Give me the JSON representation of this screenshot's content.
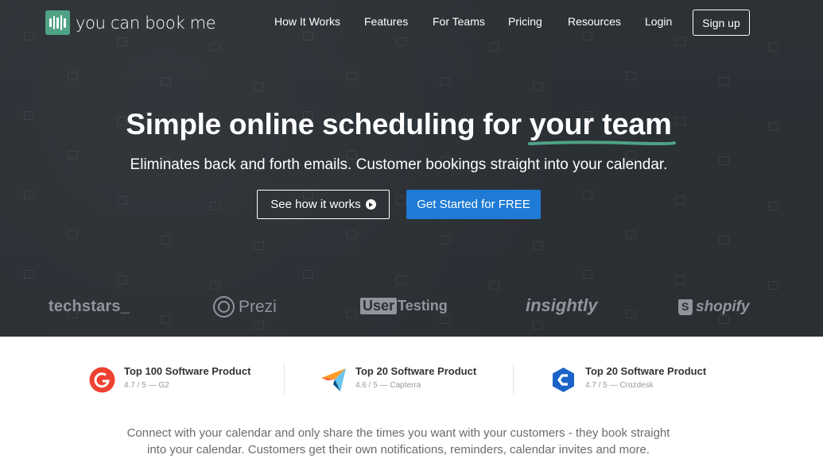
{
  "brand": {
    "name": "you can book me",
    "accent": "#4fa286"
  },
  "nav": {
    "items": [
      "How It Works",
      "Features",
      "For Teams",
      "Pricing",
      "Resources",
      "Login"
    ],
    "signup": "Sign up"
  },
  "hero": {
    "headline_main": "Simple online scheduling for",
    "headline_em": "your team",
    "subline": "Eliminates back and forth emails. Customer bookings straight into your calendar.",
    "cta_secondary": "See how it works",
    "cta_primary": "Get Started for FREE",
    "primary_color": "#1f7bd6"
  },
  "clients": [
    "techstars_",
    "Prezi",
    "User",
    "Testing",
    "insightly",
    "shopify"
  ],
  "awards": [
    {
      "title": "Top 100 Software Product",
      "rating": "4.7 / 5 — G2",
      "icon": "g2-icon"
    },
    {
      "title": "Top 20 Software Product",
      "rating": "4.6 / 5 — Capterra",
      "icon": "capterra-icon"
    },
    {
      "title": "Top 20 Software Product",
      "rating": "4.7 / 5 — Crozdesk",
      "icon": "crozdesk-icon"
    }
  ],
  "intro": "Connect with your calendar and only share the times you want with your customers - they book straight into your calendar. Customers get their own notifications, reminders, calendar invites and more."
}
